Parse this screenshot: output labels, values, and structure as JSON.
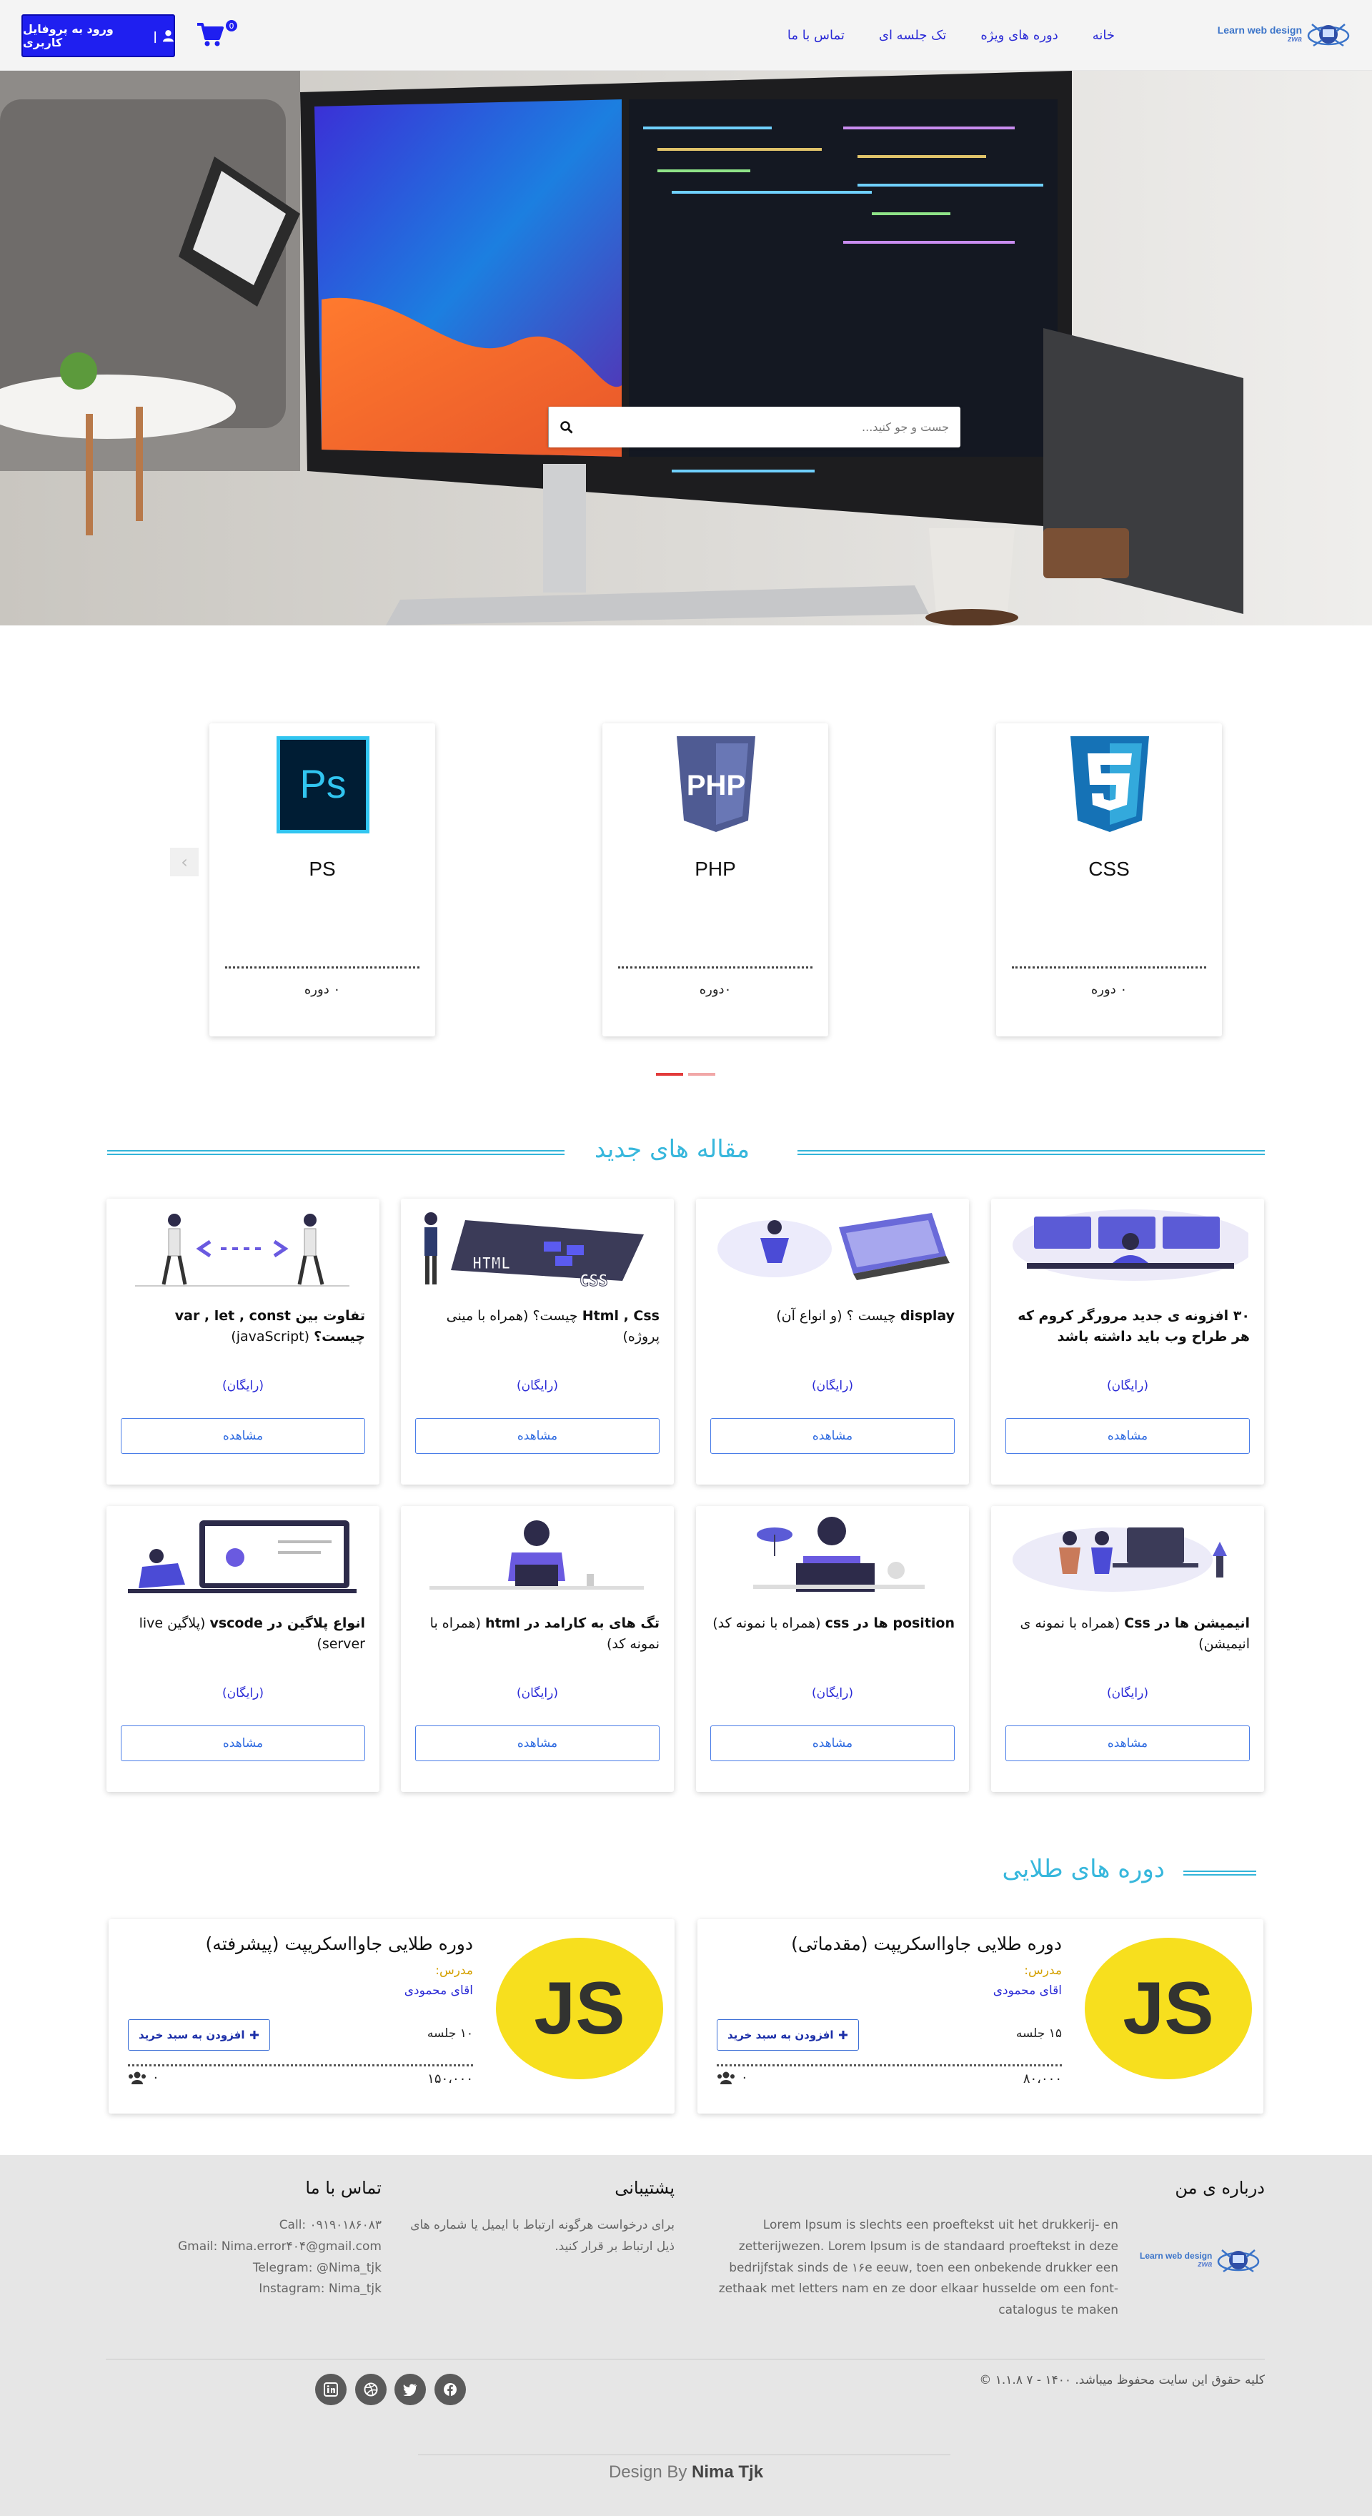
{
  "logo": {
    "line1": "Learn web design",
    "line2": "zwa"
  },
  "nav": {
    "items": [
      "خانه",
      "دوره های ویژه",
      "تک جلسه ای",
      "تماس با ما"
    ]
  },
  "header": {
    "login_label": "ورود به پروفایل کاربری",
    "cart_count": "0"
  },
  "search": {
    "placeholder": "جست و جو کنید..."
  },
  "categories": [
    {
      "name": "CSS",
      "count": "۰ دوره"
    },
    {
      "name": "PHP",
      "count": "۰دوره"
    },
    {
      "name": "PS",
      "count": "۰ دوره"
    }
  ],
  "carousel": {
    "prev": "‹",
    "next": "›"
  },
  "articles": {
    "title": "مقاله های جدید",
    "free_label": "(رایگان)",
    "button_label": "مشاهده",
    "items": [
      {
        "bold": "۳۰ افزونه ی جدید مرورگر کروم که هر طراح وب باید داشته باشد",
        "rest": ""
      },
      {
        "bold": "display",
        "rest": " چیست ؟ (و انواع آن)"
      },
      {
        "bold": "Html , Css",
        "rest": " چیست؟ (همراه با مینی پروژه)"
      },
      {
        "bold": "تفاوت بین var , let , const چیست؟",
        "rest": " (javaScript)"
      },
      {
        "bold": "انیمیشن ها در Css",
        "rest": " (همراه با نمونه ی انیمیشن)"
      },
      {
        "bold": "position ها در css",
        "rest": " (همراه با نمونه کد)"
      },
      {
        "bold": "تگ های به کارامد در html",
        "rest": " (همراه با نمونه کد)"
      },
      {
        "bold": "انواع پلاگین در vscode",
        "rest": " (پلاگین live server)"
      }
    ]
  },
  "gold": {
    "title": "دوره های طلایی",
    "teacher_label": "مدرس:",
    "add_label": "افزودن به سبد خرید",
    "logo_text": "JS",
    "items": [
      {
        "title": "دوره طلایی جاوااسکریپت (مقدماتی)",
        "teacher": "اقای محمودی",
        "sessions": "۱۵ جلسه",
        "price": "۸۰،۰۰۰",
        "students": "۰"
      },
      {
        "title": "دوره طلایی جاوااسکریپت (پیشرفته)",
        "teacher": "اقای محمودی",
        "sessions": "۱۰ جلسه",
        "price": "۱۵۰،۰۰۰",
        "students": "۰"
      }
    ]
  },
  "footer": {
    "about_title": "درباره ی من",
    "about_text": "Lorem Ipsum is slechts een proeftekst uit het drukkerij- en zetterijwezen. Lorem Ipsum is de standaard proeftekst in deze bedrijfstak sinds de ۱۶e eeuw, toen een onbekende drukker een zethaak met letters nam en ze door elkaar husselde om een font-catalogus te maken",
    "support_title": "پشتیبانی",
    "support_text": "برای درخواست هرگونه ارتباط با ایمیل یا شماره های ذیل ارتباط بر قرار کنید.",
    "contact_title": "تماس با ما",
    "contact_lines": [
      "Call: ۰۹۱۹۰۱۸۶۰۸۳",
      "Gmail: Nima.error۴۰۴@gmail.com",
      "Telegram: @Nima_tjk",
      "Instagram: Nima_tjk"
    ],
    "copyright": "کلیه حقوق این سایت محفوظ میباشد. ۱۴۰۰ - ۷ ۱.۱.۸ ©",
    "design_prefix": "Design By ",
    "design_name": "Nima Tjk"
  },
  "icons": [
    "logo-icon",
    "user-icon",
    "cart-icon",
    "search-icon",
    "ps-icon",
    "php-icon",
    "css3-icon",
    "plus-icon",
    "users-icon",
    "linkedin-icon",
    "dribbble-icon",
    "twitter-icon",
    "facebook-icon"
  ],
  "colors": {
    "brand_blue": "#1f1ff0",
    "nav_text": "#2a2ad6",
    "section_title": "#37b7dc",
    "accent_red": "#e23b3b",
    "js_yellow": "#f7df1e"
  }
}
